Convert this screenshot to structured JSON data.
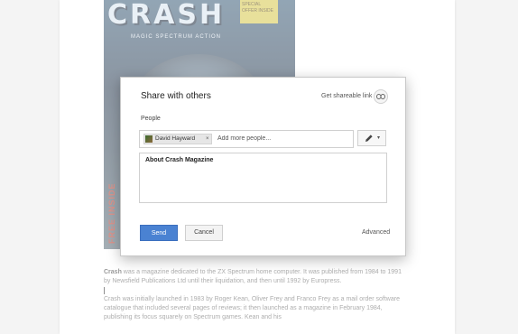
{
  "cover": {
    "logo": "CRASH",
    "tagline": "MAGIC SPECTRUM ACTION",
    "badge": "SPECIAL OFFER INSIDE",
    "side_text": "FREE INSIDE"
  },
  "dialog": {
    "title": "Share with others",
    "link_label": "Get shareable link",
    "people_label": "People",
    "chip_name": "David Hayward",
    "chip_remove": "×",
    "add_people_placeholder": "Add more people...",
    "permission_caret": "▾",
    "message": "About Crash Magazine",
    "send_label": "Send",
    "cancel_label": "Cancel",
    "advanced_label": "Advanced"
  },
  "document": {
    "p1_lead": "Crash",
    "p1_rest": " was a magazine dedicated to the ZX Spectrum home computer. It was published from 1984 to 1991 by Newsfield Publications Ltd until their liquidation, and then until 1992 by Europress.",
    "p2": "Crash was initially launched in 1983 by Roger Kean, Oliver Frey and Franco Frey as a mail order software catalogue that included several pages of reviews; it then launched as a magazine in February 1984, publishing its focus squarely on Spectrum games. Kean and his"
  },
  "colors": {
    "send_button": "#4a82d2",
    "page_background": "#ebebeb"
  }
}
